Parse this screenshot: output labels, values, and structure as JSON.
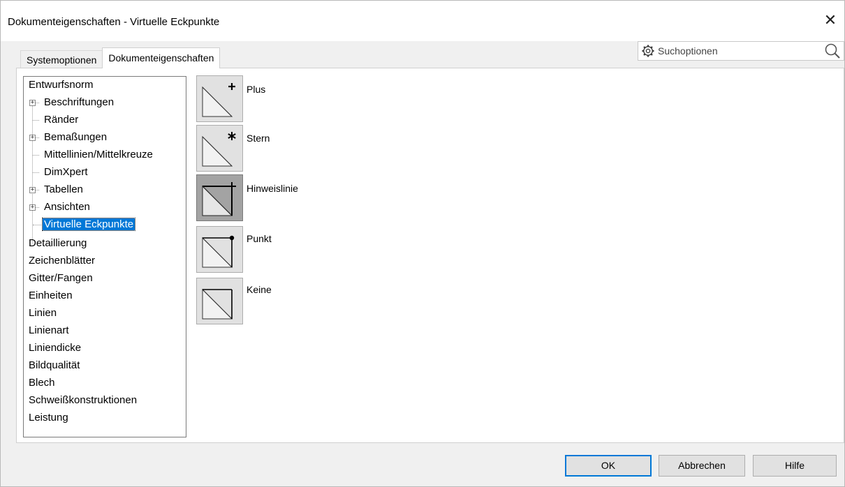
{
  "window": {
    "title": "Dokumenteigenschaften - Virtuelle Eckpunkte",
    "close_symbol": "✕"
  },
  "tabs": [
    {
      "label": "Systemoptionen",
      "active": false
    },
    {
      "label": "Dokumenteigenschaften",
      "active": true
    }
  ],
  "search": {
    "placeholder": "Suchoptionen",
    "left_icon": "gear-icon",
    "right_icon": "magnifier-icon"
  },
  "tree": {
    "items": [
      {
        "label": "Entwurfsnorm",
        "level": 0,
        "expander": false
      },
      {
        "label": "Beschriftungen",
        "level": 1,
        "expander": true
      },
      {
        "label": "Ränder",
        "level": 1,
        "expander": false
      },
      {
        "label": "Bemaßungen",
        "level": 1,
        "expander": true
      },
      {
        "label": "Mittellinien/Mittelkreuze",
        "level": 1,
        "expander": false
      },
      {
        "label": "DimXpert",
        "level": 1,
        "expander": false
      },
      {
        "label": "Tabellen",
        "level": 1,
        "expander": true
      },
      {
        "label": "Ansichten",
        "level": 1,
        "expander": true
      },
      {
        "label": "Virtuelle Eckpunkte",
        "level": 1,
        "expander": false,
        "selected": true
      },
      {
        "label": "Detaillierung",
        "level": 0,
        "expander": false
      },
      {
        "label": "Zeichenblätter",
        "level": 0,
        "expander": false
      },
      {
        "label": "Gitter/Fangen",
        "level": 0,
        "expander": false
      },
      {
        "label": "Einheiten",
        "level": 0,
        "expander": false
      },
      {
        "label": "Linien",
        "level": 0,
        "expander": false
      },
      {
        "label": "Linienart",
        "level": 0,
        "expander": false
      },
      {
        "label": "Liniendicke",
        "level": 0,
        "expander": false
      },
      {
        "label": "Bildqualität",
        "level": 0,
        "expander": false
      },
      {
        "label": "Blech",
        "level": 0,
        "expander": false
      },
      {
        "label": "Schweißkonstruktionen",
        "level": 0,
        "expander": false
      },
      {
        "label": "Leistung",
        "level": 0,
        "expander": false
      }
    ]
  },
  "options": [
    {
      "label": "Plus",
      "icon": "virtual-sharp-plus-icon",
      "selected": false
    },
    {
      "label": "Stern",
      "icon": "virtual-sharp-star-icon",
      "selected": false
    },
    {
      "label": "Hinweislinie",
      "icon": "virtual-sharp-witness-line-icon",
      "selected": true
    },
    {
      "label": "Punkt",
      "icon": "virtual-sharp-dot-icon",
      "selected": false
    },
    {
      "label": "Keine",
      "icon": "virtual-sharp-none-icon",
      "selected": false
    }
  ],
  "buttons": {
    "ok": "OK",
    "cancel": "Abbrechen",
    "help": "Hilfe"
  },
  "colors": {
    "selection": "#0078d7",
    "selected_option_bg": "#a3a3a3"
  }
}
